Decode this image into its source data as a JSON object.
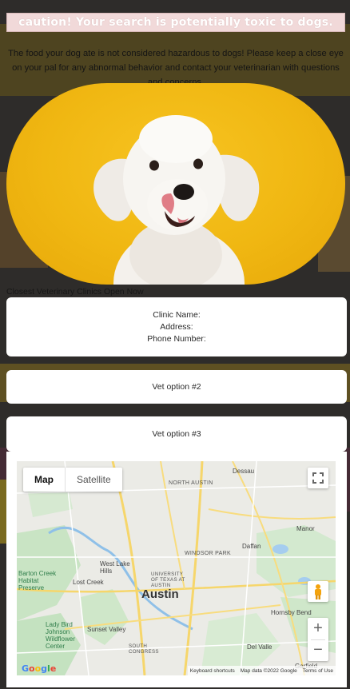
{
  "warning": {
    "text": "caution! Your search is potentially toxic to dogs."
  },
  "message": "The food your dog ate is not considered hazardous to dogs! Please keep a close eye on your pal for any abnormal behavior and contact your veterinarian with questions and concerns.",
  "hero": {
    "icon": "dog-photo"
  },
  "clinics": {
    "heading": "Closest Veterinary Clinics Open Now",
    "card1": {
      "name_label": "Clinic Name:",
      "address_label": "Address:",
      "phone_label": "Phone Number:"
    },
    "card2": {
      "label": "Vet option #2"
    },
    "card3": {
      "label": "Vet option #3"
    }
  },
  "map": {
    "type_map": "Map",
    "type_satellite": "Satellite",
    "labels": {
      "north_austin": "NORTH AUSTIN",
      "dessau": "Dessau",
      "manor": "Manor",
      "daffan": "Daffan",
      "windsor_park": "WINDSOR PARK",
      "ut": "UNIVERSITY OF TEXAS AT AUSTIN",
      "west_lake_hills": "West Lake Hills",
      "austin": "Austin",
      "barton_creek": "Barton Creek Habitat Preserve",
      "lost_creek": "Lost Creek",
      "lady_bird": "Lady Bird Johnson Wildflower Center",
      "sunset_valley": "Sunset Valley",
      "south_congress": "SOUTH CONGRESS",
      "del_valle": "Del Valle",
      "hornsby_bend": "Hornsby Bend",
      "garfield": "Garfield"
    },
    "google": [
      "G",
      "o",
      "o",
      "g",
      "l",
      "e"
    ],
    "attribution": {
      "shortcuts": "Keyboard shortcuts",
      "data": "Map data ©2022 Google",
      "terms": "Terms of Use"
    }
  }
}
